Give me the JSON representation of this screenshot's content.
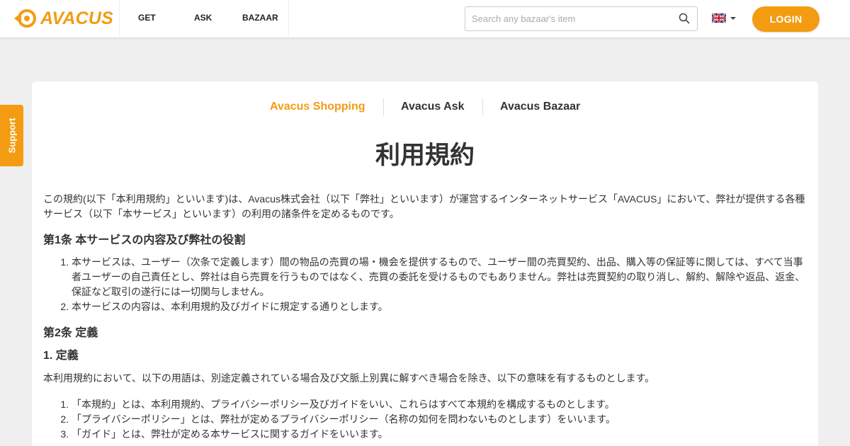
{
  "header": {
    "logo_text": "AVACUS",
    "nav": [
      "GET",
      "ASK",
      "BAZAAR"
    ],
    "search_placeholder": "Search any bazaar's item",
    "search_value": "",
    "login_label": "LOGIN"
  },
  "support_label": "Support",
  "tabs": [
    "Avacus Shopping",
    "Avacus Ask",
    "Avacus Bazaar"
  ],
  "page_title": "利用規約",
  "intro": "この規約(以下「本利用規約」といいます)は、Avacus株式会社（以下「弊社」といいます）が運営するインターネットサービス「AVACUS」において、弊社が提供する各種サービス（以下「本サービス」といいます）の利用の諸条件を定めるものです。",
  "article1": {
    "heading": "第1条 本サービスの内容及び弊社の役割",
    "items": [
      "本サービスは、ユーザー（次条で定義します）間の物品の売買の場・機会を提供するもので、ユーザー間の売買契約、出品、購入等の保証等に関しては、すべて当事者ユーザーの自己責任とし、弊社は自ら売買を行うものではなく、売買の委託を受けるものでもありません。弊社は売買契約の取り消し、解約、解除や返品、返金、保証など取引の遂行には一切関与しません。",
      "本サービスの内容は、本利用規約及びガイドに規定する通りとします。"
    ]
  },
  "article2": {
    "heading": "第2条 定義",
    "subheading": "1. 定義",
    "intro": "本利用規約において、以下の用語は、別途定義されている場合及び文脈上別異に解すべき場合を除き、以下の意味を有するものとします。",
    "items": [
      "「本規約」とは、本利用規約、プライバシーポリシー及びガイドをいい、これらはすべて本規約を構成するものとします。",
      "「プライバシーポリシー」とは、弊社が定めるプライバシーポリシー（名称の如何を問わないものとします）をいいます。",
      "「ガイド」とは、弊社が定める本サービスに関するガイドをいいます。"
    ]
  },
  "colors": {
    "accent": "#f39c12",
    "background": "#efefef",
    "text": "#333333"
  },
  "icons": {
    "search": "search-icon",
    "language": "uk-flag-icon"
  }
}
